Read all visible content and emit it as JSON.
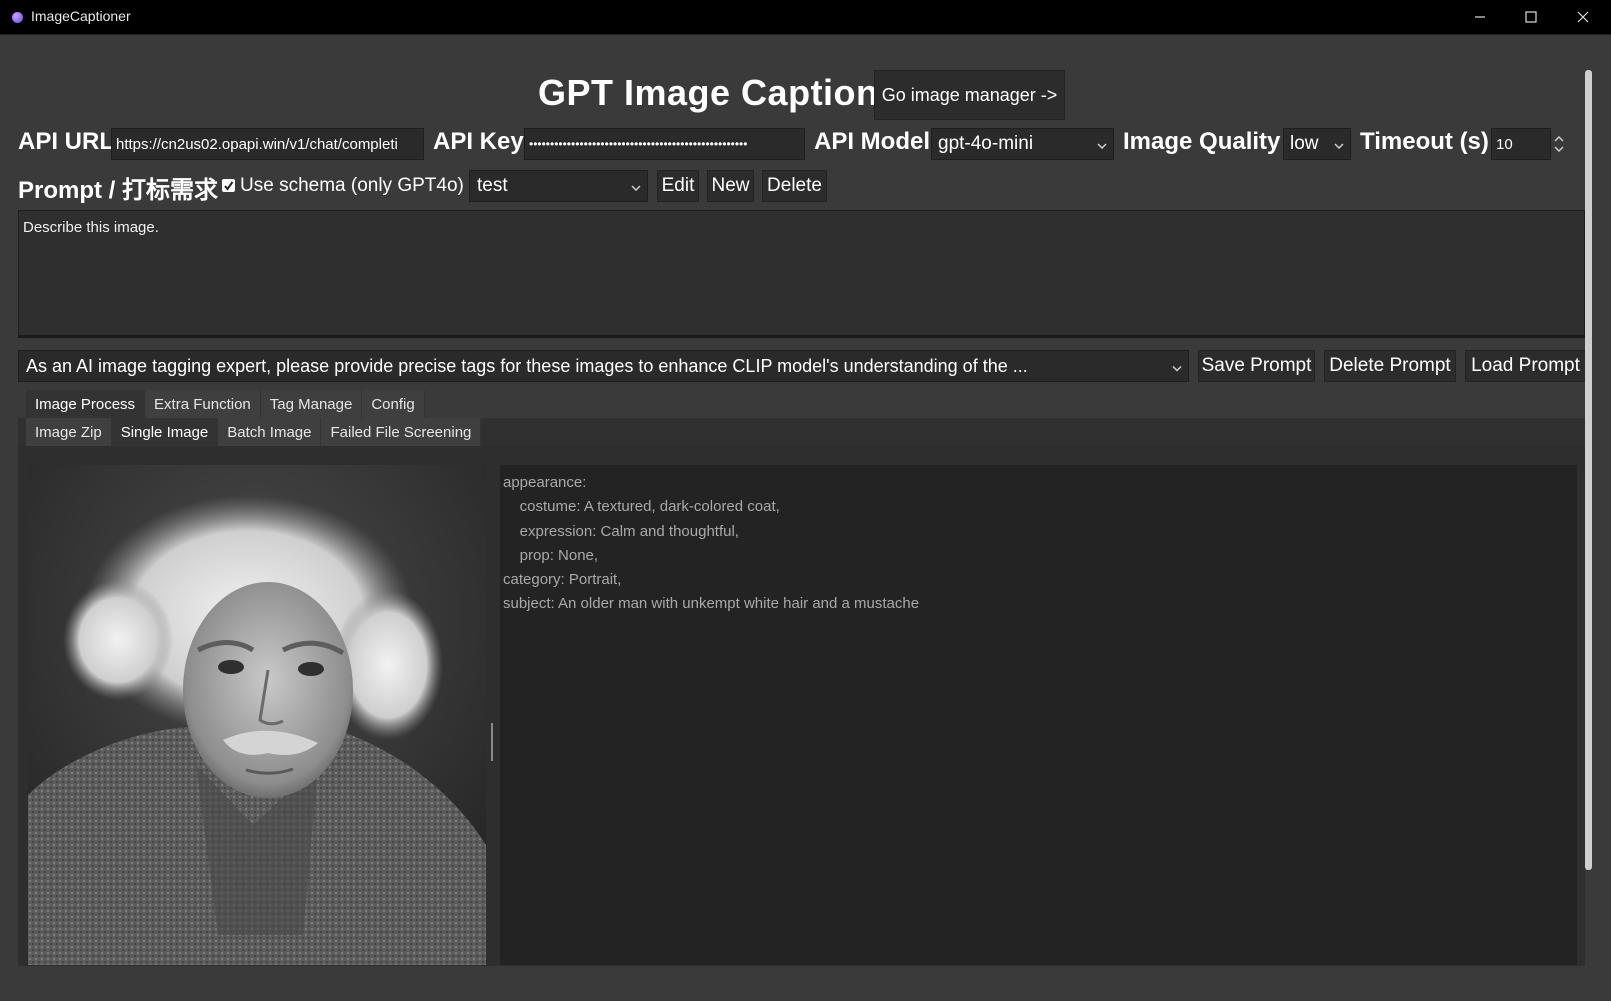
{
  "window": {
    "title": "ImageCaptioner",
    "controls": [
      "minimize",
      "maximize",
      "close"
    ]
  },
  "header": {
    "title": "GPT Image Caption",
    "go_image_manager_label": "Go image manager ->"
  },
  "api": {
    "url_label": "API URL",
    "url_value": "https://cn2us02.opapi.win/v1/chat/completi",
    "key_label": "API Key",
    "key_value": "••••••••••••••••••••••••••••••••••••••••••••••••••••",
    "model_label": "API Model",
    "model_value": "gpt-4o-mini",
    "quality_label": "Image Quality",
    "quality_value": "low",
    "timeout_label": "Timeout (s)",
    "timeout_value": "10"
  },
  "prompt": {
    "label": "Prompt / 打标需求",
    "use_schema_label": "Use schema (only GPT4o)",
    "use_schema_checked": true,
    "schema_select_value": "test",
    "edit_label": "Edit",
    "new_label": "New",
    "delete_label": "Delete",
    "text": "Describe this image.",
    "saved_prompt_value": "As an AI image tagging expert, please provide precise tags for these images to enhance CLIP model's understanding of the ...",
    "save_label": "Save Prompt",
    "delete_prompt_label": "Delete Prompt",
    "load_label": "Load Prompt"
  },
  "main_tabs": [
    {
      "label": "Image Process",
      "active": true
    },
    {
      "label": "Extra Function",
      "active": false
    },
    {
      "label": "Tag Manage",
      "active": false
    },
    {
      "label": "Config",
      "active": false
    }
  ],
  "sub_tabs": [
    {
      "label": "Image Zip",
      "active": false
    },
    {
      "label": "Single Image",
      "active": true
    },
    {
      "label": "Batch Image",
      "active": false
    },
    {
      "label": "Failed File Screening",
      "active": false
    }
  ],
  "result": {
    "lines": [
      "appearance:",
      "    costume: A textured, dark-colored coat,",
      "    expression: Calm and thoughtful,",
      "    prop: None,",
      "category: Portrait,",
      "subject: An older man with unkempt white hair and a mustache"
    ]
  },
  "colors": {
    "background": "#3a3a3a",
    "titlebar": "#000000",
    "input_bg": "#2a2a2a",
    "result_bg": "#232323",
    "caption_text": "#a9a9a9"
  },
  "icons": [
    "app-icon",
    "minimize-icon",
    "maximize-icon",
    "close-icon",
    "chevron-down-icon",
    "checkbox-checked-icon",
    "spinner-arrows-icon"
  ]
}
